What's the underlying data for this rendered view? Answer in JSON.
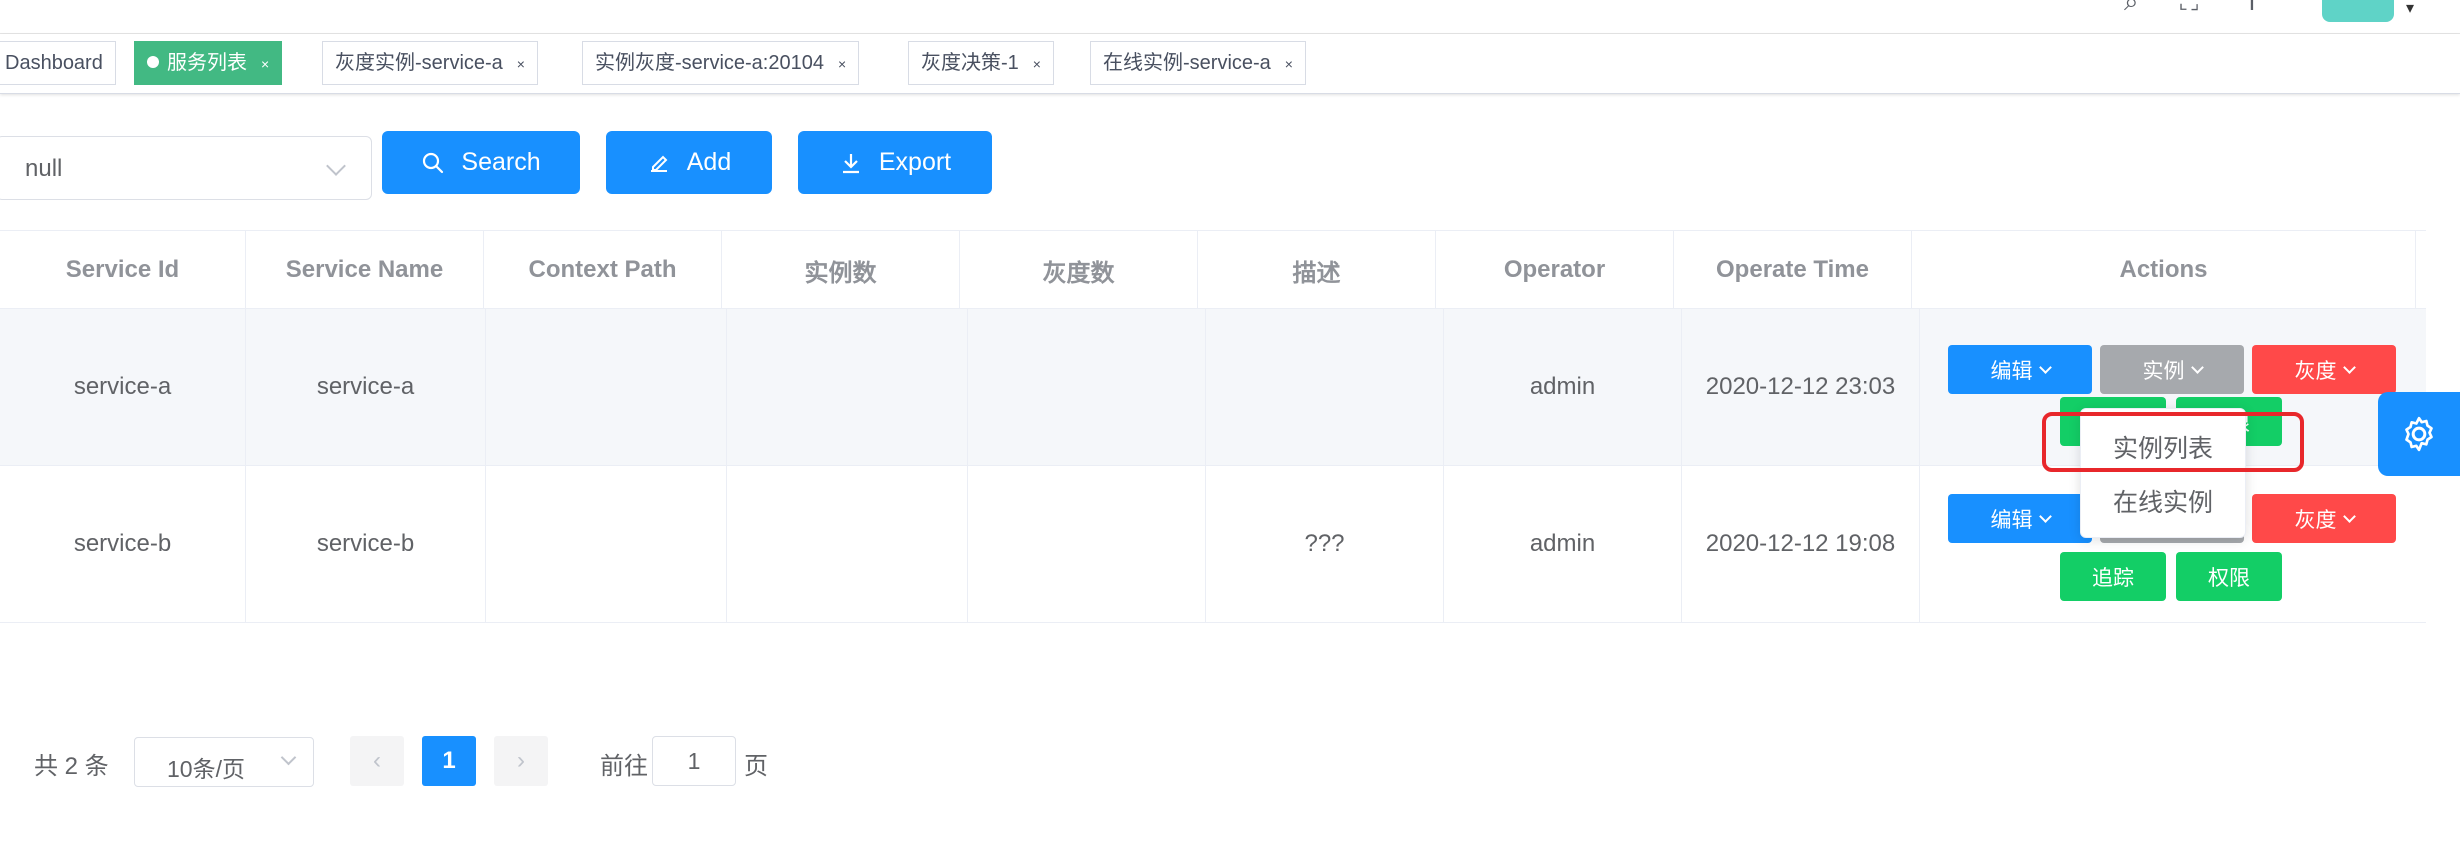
{
  "tags": [
    {
      "label": "Dashboard",
      "active": false,
      "closable": false
    },
    {
      "label": "服务列表",
      "active": true,
      "closable": true
    },
    {
      "label": "灰度实例-service-a",
      "active": false,
      "closable": true
    },
    {
      "label": "实例灰度-service-a:20104",
      "active": false,
      "closable": true
    },
    {
      "label": "灰度决策-1",
      "active": false,
      "closable": true
    },
    {
      "label": "在线实例-service-a",
      "active": false,
      "closable": true
    }
  ],
  "close_glyph": "×",
  "filter": {
    "select_value": "null"
  },
  "buttons": {
    "search": "Search",
    "add": "Add",
    "export": "Export"
  },
  "table": {
    "columns": [
      "Service Id",
      "Service Name",
      "Context Path",
      "实例数",
      "灰度数",
      "描述",
      "Operator",
      "Operate Time",
      "Actions"
    ],
    "rows": [
      {
        "service_id": "service-a",
        "service_name": "service-a",
        "context_path": "",
        "instances": "",
        "gray": "",
        "desc": "",
        "operator": "admin",
        "operate_time": "2020-12-12 23:03"
      },
      {
        "service_id": "service-b",
        "service_name": "service-b",
        "context_path": "",
        "instances": "",
        "gray": "",
        "desc": "???",
        "operator": "admin",
        "operate_time": "2020-12-12 19:08"
      }
    ],
    "actions": {
      "edit": "编辑",
      "instance": "实例",
      "gray": "灰度",
      "trace": "追踪",
      "permission": "权限"
    }
  },
  "dropdown": {
    "items": [
      "实例列表",
      "在线实例"
    ]
  },
  "pagination": {
    "total": "共 2 条",
    "page_size": "10条/页",
    "current_page": "1",
    "goto_prefix": "前往",
    "goto_value": "1",
    "goto_suffix": "页",
    "prev_glyph": "‹",
    "next_glyph": "›"
  },
  "colors": {
    "primary": "#1890ff",
    "success": "#13ce66",
    "danger": "#ff4949",
    "info": "#a6a9ad",
    "tag_active": "#42b983",
    "highlight": "#e8272b"
  }
}
